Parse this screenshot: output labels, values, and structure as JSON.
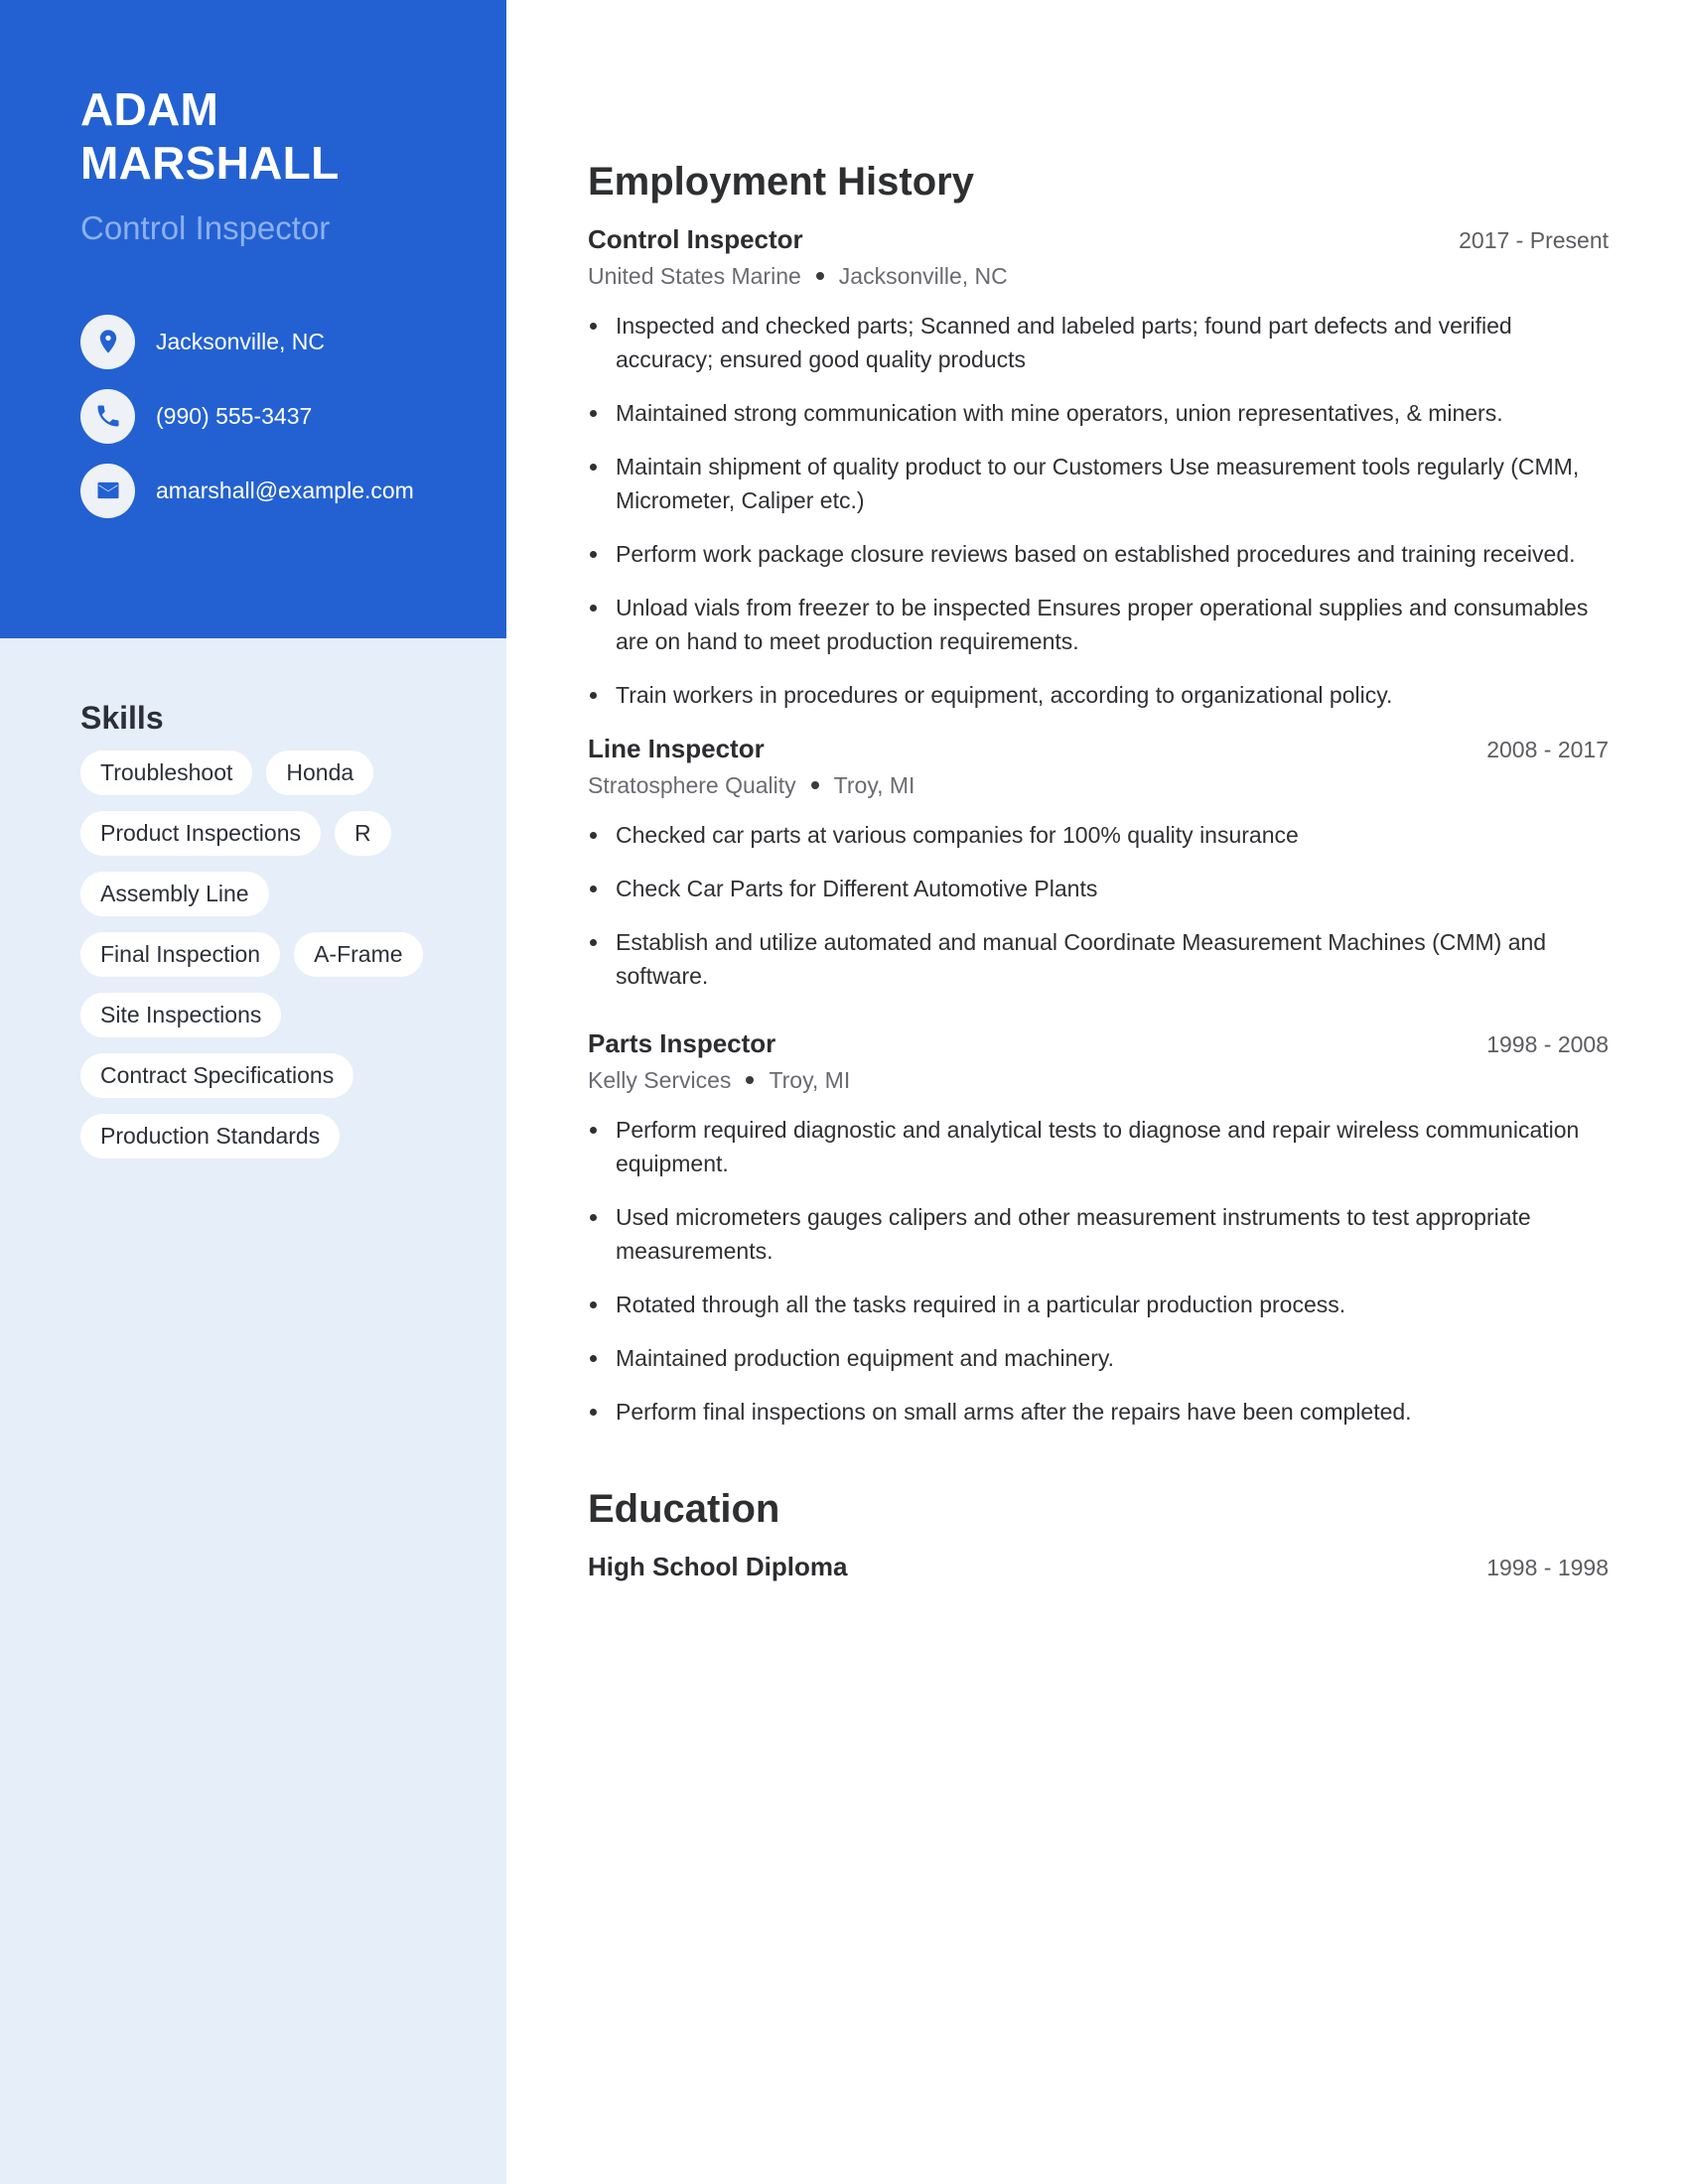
{
  "profile": {
    "first_name": "ADAM",
    "last_name": "MARSHALL",
    "title": "Control Inspector"
  },
  "contacts": [
    {
      "icon": "location-pin-icon",
      "text": "Jacksonville, NC"
    },
    {
      "icon": "phone-icon",
      "text": "(990) 555-3437"
    },
    {
      "icon": "email-icon",
      "text": "amarshall@example.com"
    }
  ],
  "skills": {
    "heading": "Skills",
    "items": [
      "Troubleshoot",
      "Honda",
      "Product Inspections",
      "R",
      "Assembly Line",
      "Final Inspection",
      "A-Frame",
      "Site Inspections",
      "Contract Specifications",
      "Production Standards"
    ]
  },
  "employment": {
    "heading": "Employment History",
    "jobs": [
      {
        "title": "Control Inspector",
        "dates": "2017 - Present",
        "company": "United States Marine",
        "location": "Jacksonville, NC",
        "bullets": [
          "Inspected and checked parts; Scanned and labeled parts; found part defects and verified accuracy; ensured good quality products",
          "Maintained strong communication with mine operators, union representatives, & miners.",
          "Maintain shipment of quality product to our Customers Use measurement tools regularly (CMM, Micrometer, Caliper etc.)",
          "Perform work package closure reviews based on established procedures and training received.",
          "Unload vials from freezer to be inspected Ensures proper operational supplies and consumables are on hand to meet production requirements.",
          "Train workers in procedures or equipment, according to organizational policy."
        ]
      },
      {
        "title": "Line Inspector",
        "dates": "2008 - 2017",
        "company": "Stratosphere Quality",
        "location": "Troy, MI",
        "bullets": [
          "Checked car parts at various companies for 100% quality insurance",
          "Check Car Parts for Different Automotive Plants",
          "Establish and utilize automated and manual Coordinate Measurement Machines (CMM) and software."
        ]
      },
      {
        "title": "Parts Inspector",
        "dates": "1998 - 2008",
        "company": "Kelly Services",
        "location": "Troy, MI",
        "bullets": [
          "Perform required diagnostic and analytical tests to diagnose and repair wireless communication equipment.",
          "Used micrometers gauges calipers and other measurement instruments to test appropriate measurements.",
          "Rotated through all the tasks required in a particular production process.",
          "Maintained production equipment and machinery.",
          "Perform final inspections on small arms after the repairs have been completed."
        ]
      }
    ]
  },
  "education": {
    "heading": "Education",
    "items": [
      {
        "degree": "High School Diploma",
        "dates": "1998 - 1998"
      }
    ]
  },
  "colors": {
    "accent": "#2361d2",
    "sidebar_bg": "#e6eef9",
    "subtitle": "#8cb0ee"
  }
}
